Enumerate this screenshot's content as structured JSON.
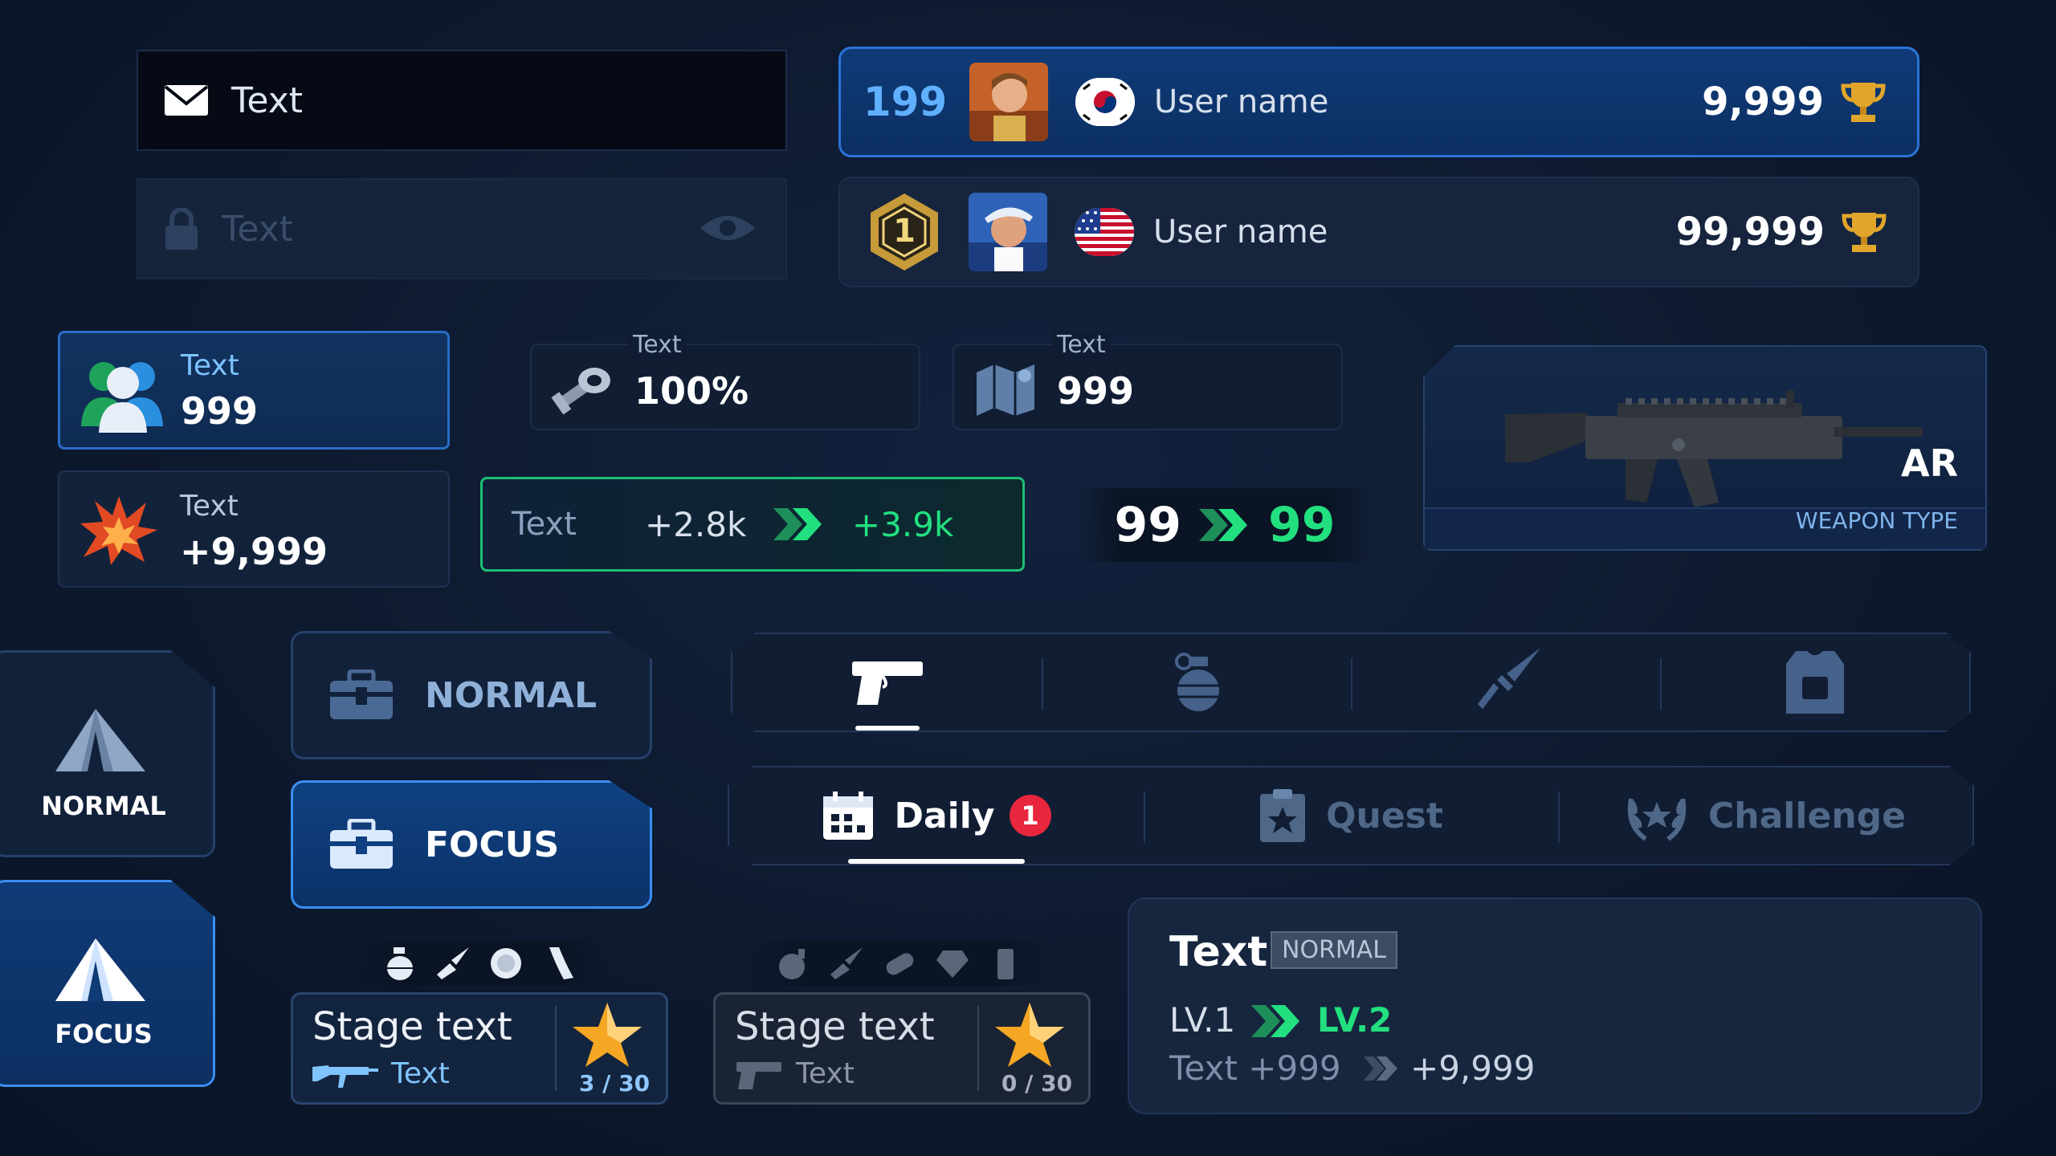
{
  "inputs": {
    "active": {
      "text": "Text",
      "icon": "envelope-icon"
    },
    "disabled": {
      "text": "Text",
      "icon": "lock-icon",
      "trailing_icon": "eye-icon"
    }
  },
  "leaderboard": [
    {
      "rank": "199",
      "name": "User name",
      "score": "9,999",
      "flag": "south-korea-flag",
      "highlighted": true
    },
    {
      "rank": "1",
      "rank_style": "gold-hexagon-medal",
      "name": "User name",
      "score": "99,999",
      "flag": "usa-flag",
      "highlighted": false
    }
  ],
  "stats": {
    "friends": {
      "label": "Text",
      "value": "999",
      "icon": "users-icon"
    },
    "damage": {
      "label": "Text",
      "value": "+9,999",
      "icon": "explosion-icon"
    },
    "parts": {
      "label": "Text",
      "value": "100%",
      "icon": "bolt-nut-icon"
    },
    "map": {
      "label": "Text",
      "value": "999",
      "icon": "map-icon"
    }
  },
  "compare": {
    "label": "Text",
    "old": "+2.8k",
    "new": "+3.9k"
  },
  "compare_small": {
    "old": "99",
    "new": "99"
  },
  "weapon": {
    "type_short": "AR",
    "type_long": "WEAPON TYPE"
  },
  "modes": {
    "tile_normal": "NORMAL",
    "tile_focus": "FOCUS",
    "btn_normal": "NORMAL",
    "btn_focus": "FOCUS"
  },
  "weapon_tabs": [
    {
      "icon": "pistol-icon",
      "active": true
    },
    {
      "icon": "grenade-icon",
      "active": false
    },
    {
      "icon": "knife-icon",
      "active": false
    },
    {
      "icon": "vest-icon",
      "active": false
    }
  ],
  "mission_tabs": [
    {
      "label": "Daily",
      "icon": "calendar-icon",
      "badge": "1",
      "active": true
    },
    {
      "label": "Quest",
      "icon": "clipboard-star-icon",
      "active": false
    },
    {
      "label": "Challenge",
      "icon": "laurel-icon",
      "active": false
    }
  ],
  "stages": [
    {
      "title": "Stage text",
      "sub": "Text",
      "progress": "3 / 30",
      "style": "active"
    },
    {
      "title": "Stage text",
      "sub": "Text",
      "progress": "0 / 30",
      "style": "inactive"
    }
  ],
  "level_card": {
    "title": "Text",
    "tag": "NORMAL",
    "lv_old": "LV.1",
    "lv_new": "LV.2",
    "stat_old": "Text +999",
    "stat_new": "+9,999"
  },
  "colors": {
    "background": "#0c172b",
    "accent_blue": "#2a73d6",
    "accent_green": "#22e07f",
    "badge_red": "#e8263d",
    "gold": "#e0a52a"
  }
}
